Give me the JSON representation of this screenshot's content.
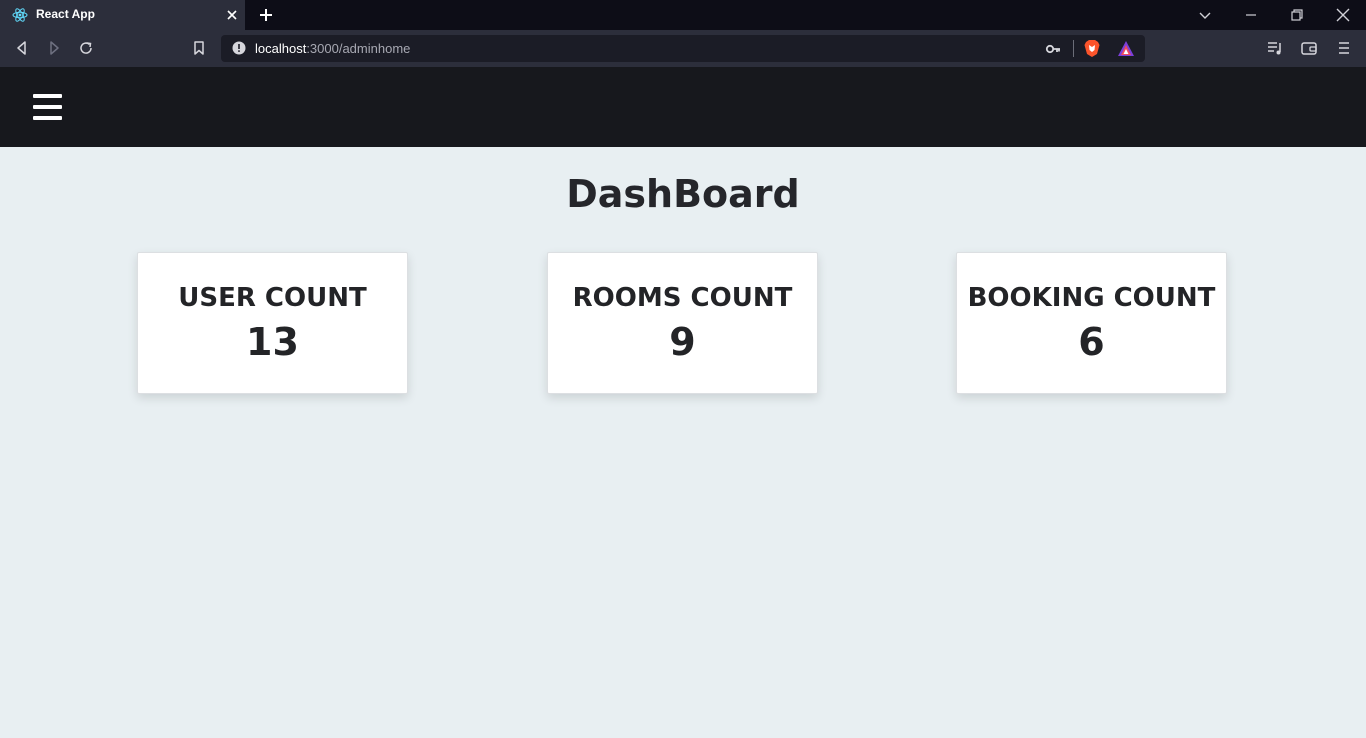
{
  "browser": {
    "tab": {
      "title": "React App",
      "favicon": "react-logo-icon"
    },
    "url": {
      "host": "localhost",
      "rest": ":3000/adminhome"
    },
    "icons": [
      "back-icon",
      "forward-icon",
      "reload-icon",
      "bookmark-icon",
      "site-info-icon",
      "key-icon",
      "brave-shields-icon",
      "brave-rewards-icon",
      "playlist-icon",
      "wallet-icon",
      "menu-icon"
    ]
  },
  "app": {
    "header": {
      "menu_icon": "hamburger-icon"
    },
    "title": "DashBoard",
    "cards": [
      {
        "label": "USER COUNT",
        "value": "13"
      },
      {
        "label": "ROOMS COUNT",
        "value": "9"
      },
      {
        "label": "BOOKING COUNT",
        "value": "6"
      }
    ]
  },
  "colors": {
    "page_bg": "#e8eff2",
    "header_bg": "#17181d",
    "browser_chrome": "#2c2e3b",
    "card_bg": "#ffffff",
    "text": "#232427"
  }
}
